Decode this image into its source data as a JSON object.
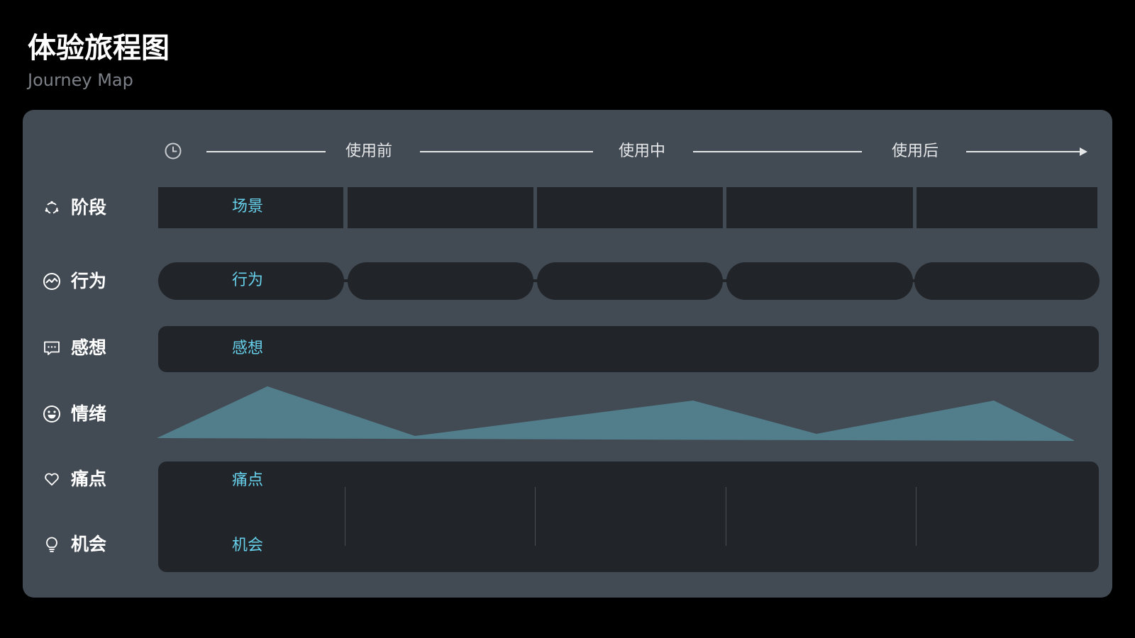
{
  "header": {
    "title": "体验旅程图",
    "subtitle": "Journey Map"
  },
  "timeline": {
    "icon": "clock-icon",
    "phases": [
      "使用前",
      "使用中",
      "使用后"
    ]
  },
  "rows": {
    "stage": {
      "label": "阶段",
      "icon": "cycle-icon",
      "cell_text": "场景"
    },
    "behavior": {
      "label": "行为",
      "icon": "activity-icon",
      "cell_text": "行为"
    },
    "feeling": {
      "label": "感想",
      "icon": "chat-icon",
      "cell_text": "感想"
    },
    "emotion": {
      "label": "情绪",
      "icon": "smile-icon"
    },
    "pain": {
      "label": "痛点",
      "icon": "heart-icon",
      "cell_text": "痛点"
    },
    "opportunity": {
      "label": "机会",
      "icon": "lightbulb-icon",
      "cell_text": "机会"
    }
  },
  "colors": {
    "background": "#000000",
    "board": "#424a53",
    "cell": "#212429",
    "accent_text": "#67d0ea",
    "emotion_fill": "#527e8c"
  }
}
